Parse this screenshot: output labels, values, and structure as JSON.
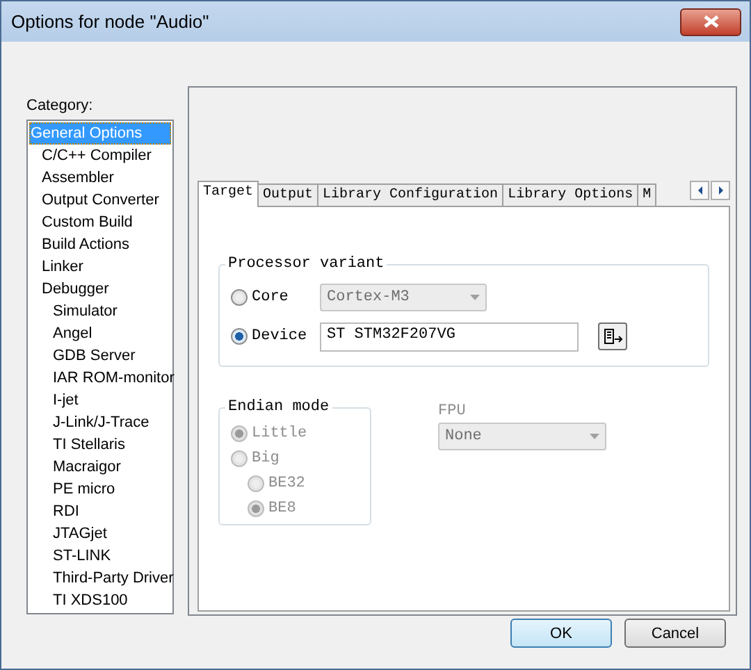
{
  "window": {
    "title": "Options for node \"Audio\""
  },
  "category": {
    "label": "Category:",
    "items": [
      {
        "label": "General Options",
        "selected": true
      },
      {
        "label": "C/C++ Compiler",
        "selected": false
      },
      {
        "label": "Assembler",
        "selected": false
      },
      {
        "label": "Output Converter",
        "selected": false
      },
      {
        "label": "Custom Build",
        "selected": false
      },
      {
        "label": "Build Actions",
        "selected": false
      },
      {
        "label": "Linker",
        "selected": false
      },
      {
        "label": "Debugger",
        "selected": false,
        "children": [
          {
            "label": "Simulator",
            "selected": false
          },
          {
            "label": "Angel",
            "selected": false
          },
          {
            "label": "GDB Server",
            "selected": false
          },
          {
            "label": "IAR ROM-monitor",
            "selected": false
          },
          {
            "label": "I-jet",
            "selected": false
          },
          {
            "label": "J-Link/J-Trace",
            "selected": false
          },
          {
            "label": "TI Stellaris",
            "selected": false
          },
          {
            "label": "Macraigor",
            "selected": false
          },
          {
            "label": "PE micro",
            "selected": false
          },
          {
            "label": "RDI",
            "selected": false
          },
          {
            "label": "JTAGjet",
            "selected": false
          },
          {
            "label": "ST-LINK",
            "selected": false
          },
          {
            "label": "Third-Party Driver",
            "selected": false
          },
          {
            "label": "TI XDS100",
            "selected": false
          }
        ]
      }
    ]
  },
  "tabs": [
    {
      "label": "Target",
      "selected": true
    },
    {
      "label": "Output",
      "selected": false
    },
    {
      "label": "Library Configuration",
      "selected": false
    },
    {
      "label": "Library Options",
      "selected": false
    },
    {
      "label": "M",
      "selected": false
    }
  ],
  "processor_variant": {
    "title": "Processor variant",
    "options": [
      {
        "label": "Core",
        "selected": false,
        "kind": "dropdown",
        "value": "Cortex-M3",
        "disabled": true
      },
      {
        "label": "Device",
        "selected": true,
        "kind": "text",
        "value": "ST STM32F207VG"
      }
    ]
  },
  "endian_mode": {
    "title": "Endian mode",
    "disabled": true,
    "options": [
      {
        "label": "Little",
        "selected": true
      },
      {
        "label": "Big",
        "selected": false,
        "children": [
          {
            "label": "BE32",
            "selected": false
          },
          {
            "label": "BE8",
            "selected": true
          }
        ]
      }
    ]
  },
  "fpu": {
    "label": "FPU",
    "value": "None",
    "disabled": true
  },
  "buttons": [
    {
      "label": "OK",
      "default": true
    },
    {
      "label": "Cancel",
      "default": false
    }
  ]
}
